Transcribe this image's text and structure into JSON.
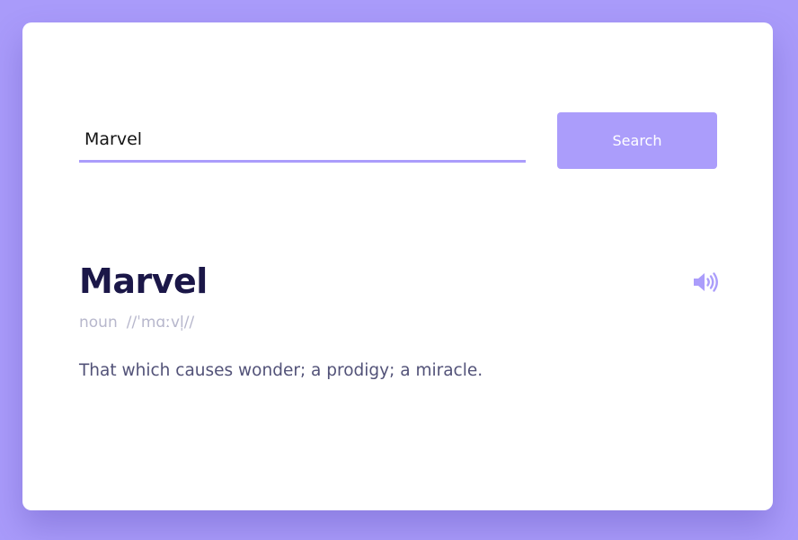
{
  "search": {
    "value": "Marvel",
    "button_label": "Search"
  },
  "result": {
    "word": "Marvel",
    "part_of_speech": "noun",
    "phonetic": "//ˈmɑːvl̩//",
    "definition": "That which causes wonder; a prodigy; a miracle.",
    "audio_icon": "speaker-volume-icon"
  },
  "colors": {
    "background": "#a99bfa",
    "card": "#ffffff",
    "accent": "#ab9dfb",
    "word": "#1b1748",
    "meta": "#b7b7cc",
    "definition": "#525278"
  }
}
